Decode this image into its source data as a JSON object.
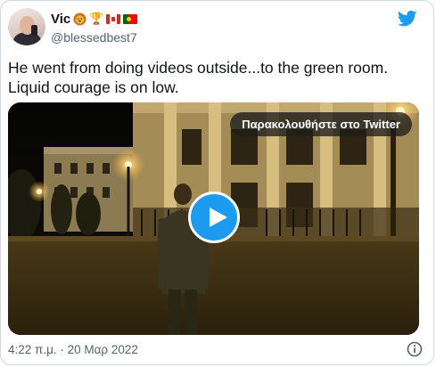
{
  "tweet": {
    "author": {
      "display_name": "Vic",
      "handle": "@blessedbest7",
      "badges": [
        "lion",
        "🏆",
        "flag-canada",
        "flag-portugal"
      ]
    },
    "text_line1": "He went from doing videos outside...to the green room.",
    "text_line2": "Liquid courage is on low.",
    "media": {
      "watch_label": "Παρακολουθήστε στο Twitter",
      "type": "video"
    },
    "timestamp": "4:22 π.μ. · 20 Μαρ 2022"
  },
  "icons": {
    "brand": "twitter-bird-icon",
    "info": "info-icon",
    "play": "play-icon"
  },
  "colors": {
    "brand_blue": "#1d9bf0",
    "text_primary": "#0f1419",
    "text_secondary": "#536471",
    "border": "#cfd9de"
  }
}
